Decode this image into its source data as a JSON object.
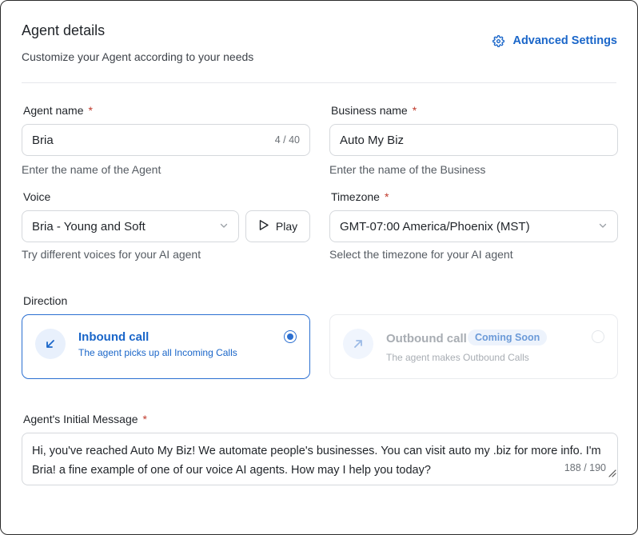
{
  "header": {
    "title": "Agent details",
    "subtitle": "Customize your Agent according to your needs",
    "advanced_settings": "Advanced Settings"
  },
  "agent_name": {
    "label": "Agent name",
    "required": "*",
    "value": "Bria",
    "counter": "4 / 40",
    "hint": "Enter the name of the Agent"
  },
  "business_name": {
    "label": "Business name",
    "required": "*",
    "value": "Auto My Biz",
    "hint": "Enter the name of the Business"
  },
  "voice": {
    "label": "Voice",
    "selected": "Bria - Young and Soft",
    "play_label": "Play",
    "hint": "Try different voices for your AI agent"
  },
  "timezone": {
    "label": "Timezone",
    "required": "*",
    "selected": "GMT-07:00 America/Phoenix (MST)",
    "hint": "Select the timezone for your AI agent"
  },
  "direction": {
    "label": "Direction",
    "inbound": {
      "title": "Inbound call",
      "description": "The agent picks up all Incoming Calls",
      "selected": true
    },
    "outbound": {
      "title": "Outbound call",
      "badge": "Coming Soon",
      "description": "The agent makes Outbound Calls",
      "selected": false
    }
  },
  "initial_message": {
    "label": "Agent's Initial Message",
    "required": "*",
    "value": "Hi, you've reached Auto My Biz! We automate people's businesses. You can visit auto my .biz for more info. I'm Bria! a fine example of one of our voice AI agents. How may I help you today?",
    "counter": "188 / 190"
  },
  "colors": {
    "accent": "#1a66c9",
    "border": "#d5d8dc",
    "required": "#c0392b",
    "disabled_text": "#a8adb3"
  },
  "icons": {
    "advanced_settings": "gear-icon",
    "voice_dropdown": "chevron-down-icon",
    "play": "play-icon",
    "timezone_dropdown": "chevron-down-icon",
    "inbound": "arrow-down-left-icon",
    "outbound": "arrow-up-right-icon",
    "resize": "resize-handle-icon"
  }
}
